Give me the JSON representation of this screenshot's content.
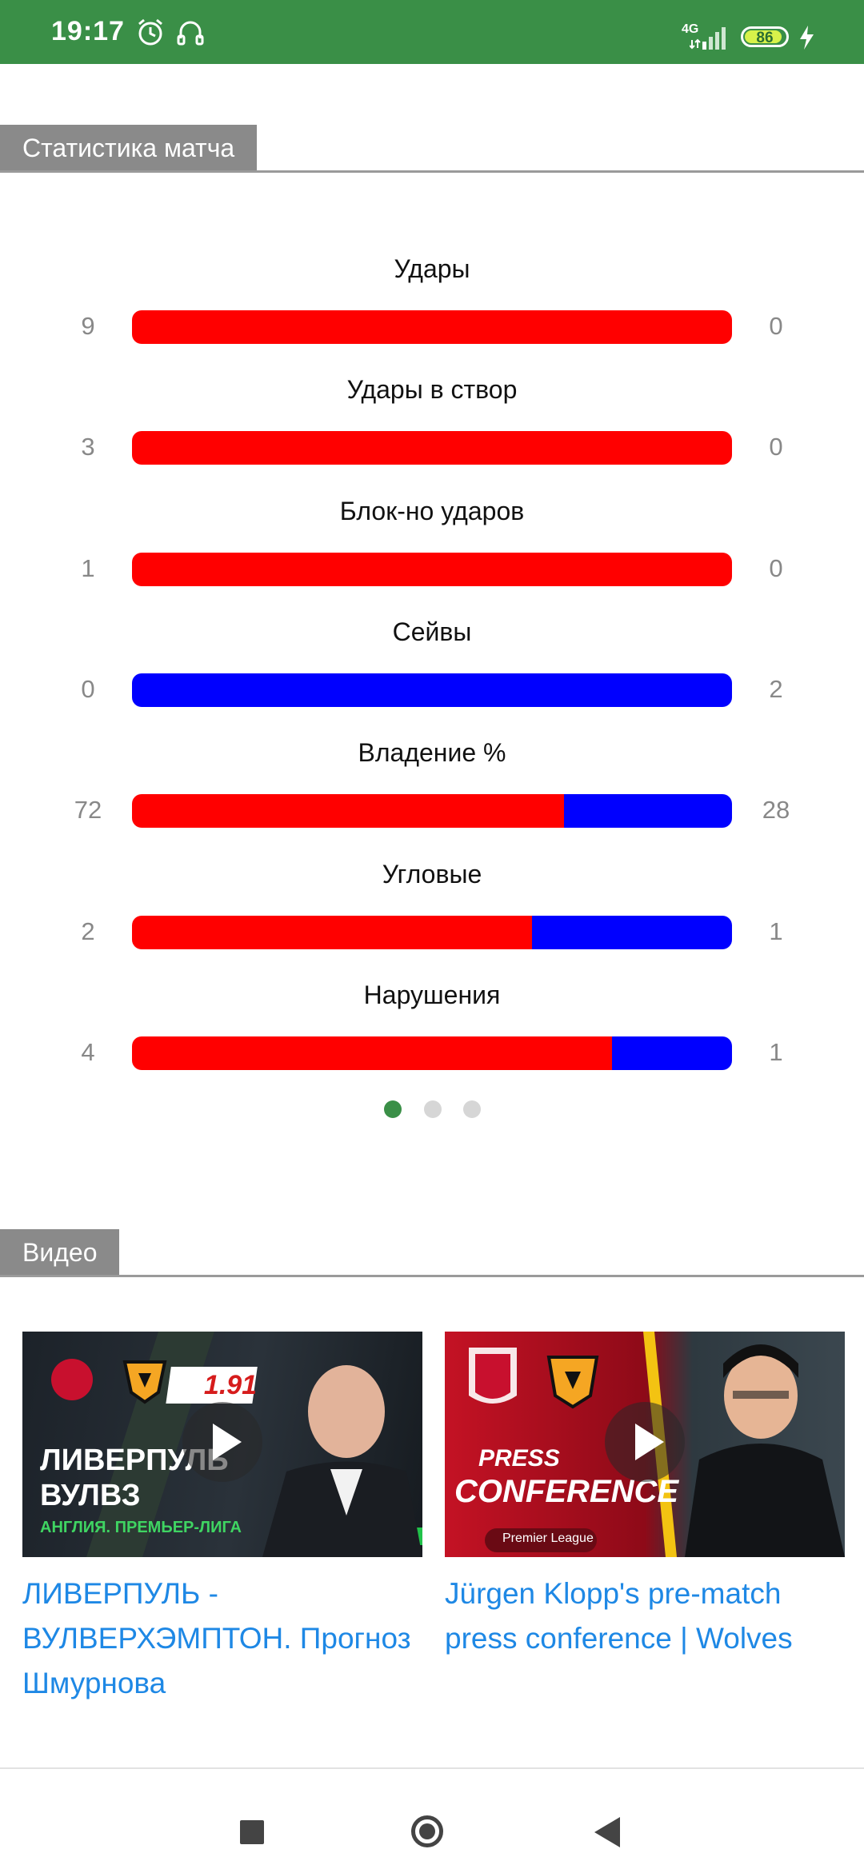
{
  "status_bar": {
    "time": "19:17",
    "network": "4G",
    "battery": "86",
    "icons": [
      "alarm-icon",
      "headset-icon",
      "signal-icon",
      "battery-icon",
      "charging-icon"
    ]
  },
  "stats_section": {
    "title": "Статистика матча",
    "colors": {
      "home": "#ff0000",
      "away": "#0000ff"
    },
    "items": [
      {
        "label": "Удары",
        "home": "9",
        "away": "0",
        "home_value": 9,
        "away_value": 0
      },
      {
        "label": "Удары в створ",
        "home": "3",
        "away": "0",
        "home_value": 3,
        "away_value": 0
      },
      {
        "label": "Блок-но ударов",
        "home": "1",
        "away": "0",
        "home_value": 1,
        "away_value": 0
      },
      {
        "label": "Сейвы",
        "home": "0",
        "away": "2",
        "home_value": 0,
        "away_value": 2
      },
      {
        "label": "Владение %",
        "home": "72",
        "away": "28",
        "home_value": 72,
        "away_value": 28
      },
      {
        "label": "Угловые",
        "home": "2",
        "away": "1",
        "home_value": 2,
        "away_value": 1
      },
      {
        "label": "Нарушения",
        "home": "4",
        "away": "1",
        "home_value": 4,
        "away_value": 1
      }
    ],
    "pager": {
      "count": 3,
      "active": 1
    }
  },
  "video_section": {
    "title": "Видео",
    "videos": [
      {
        "title": "ЛИВЕРПУЛЬ - ВУЛВЕРХЭМПТОН. Прогноз Шмурнова",
        "thumb_odds": "1.91",
        "thumb_line1": "ЛИВЕРПУЛЬ",
        "thumb_line2": "ВУЛВЗ",
        "thumb_line3": "АНГЛИЯ. ПРЕМЬЕР-ЛИГА"
      },
      {
        "title": "Jürgen Klopp's pre-match press conference | Wolves",
        "thumb_line1": "PRESS",
        "thumb_line2": "CONFERENCE",
        "thumb_line3": "Premier League"
      }
    ]
  },
  "nav_bar": {
    "buttons": [
      "recents-button",
      "home-button",
      "back-button"
    ]
  }
}
